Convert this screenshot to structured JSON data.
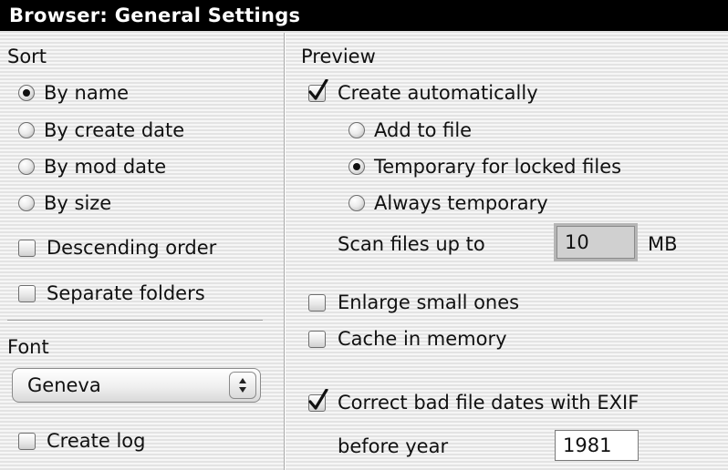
{
  "window": {
    "title": "Browser: General Settings"
  },
  "sort": {
    "heading": "Sort",
    "options": [
      {
        "label": "By name",
        "selected": true
      },
      {
        "label": "By create date",
        "selected": false
      },
      {
        "label": "By mod date",
        "selected": false
      },
      {
        "label": "By size",
        "selected": false
      }
    ],
    "descending": {
      "label": "Descending order",
      "checked": false
    },
    "separate_folders": {
      "label": "Separate folders",
      "checked": false
    }
  },
  "font": {
    "heading": "Font",
    "selected": "Geneva",
    "create_log": {
      "label": "Create log",
      "checked": false
    }
  },
  "preview": {
    "heading": "Preview",
    "create_automatically": {
      "label": "Create automatically",
      "checked": true
    },
    "options": [
      {
        "label": "Add to file",
        "selected": false
      },
      {
        "label": "Temporary for locked files",
        "selected": true
      },
      {
        "label": "Always temporary",
        "selected": false
      }
    ],
    "scan": {
      "label": "Scan files up to",
      "value": "10",
      "unit": "MB"
    },
    "enlarge": {
      "label": "Enlarge small ones",
      "checked": false
    },
    "cache": {
      "label": "Cache in memory",
      "checked": false
    },
    "exif": {
      "label": "Correct bad file dates with EXIF",
      "checked": true
    },
    "before_year": {
      "label": "before year",
      "value": "1981"
    }
  },
  "icons": {
    "radio": "radio-button-icon",
    "check": "checkmark-icon",
    "popup_arrows": "up-down-arrows-icon"
  },
  "colors": {
    "titlebar_bg": "#000000",
    "titlebar_fg": "#ffffff"
  }
}
